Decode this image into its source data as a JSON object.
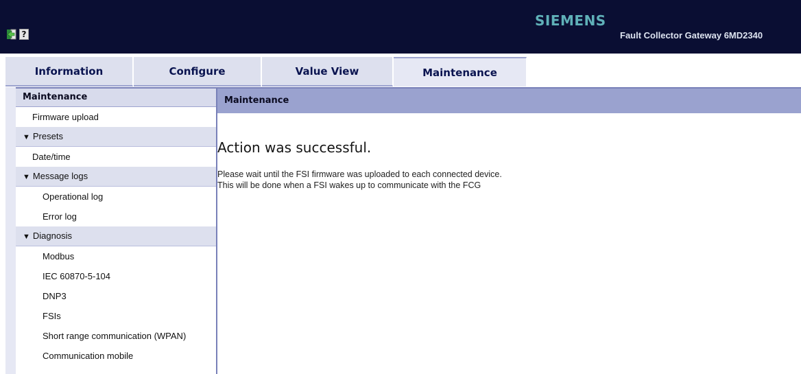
{
  "header": {
    "brand": "SIEMENS",
    "product": "Fault Collector Gateway 6MD2340",
    "icons": [
      "exit-icon",
      "help-icon"
    ],
    "help_glyph": "?"
  },
  "tabs": [
    {
      "label": "Information",
      "active": false
    },
    {
      "label": "Configure",
      "active": false
    },
    {
      "label": "Value View",
      "active": false
    },
    {
      "label": "Maintenance",
      "active": true
    }
  ],
  "sidebar": {
    "title": "Maintenance",
    "items": [
      {
        "label": "Firmware upload"
      },
      {
        "label": "Presets",
        "type": "group"
      },
      {
        "label": "Date/time"
      },
      {
        "label": "Message logs",
        "type": "group"
      },
      {
        "label": "Operational log"
      },
      {
        "label": "Error log"
      },
      {
        "label": "Diagnosis",
        "type": "group"
      },
      {
        "label": "Modbus"
      },
      {
        "label": "IEC 60870-5-104"
      },
      {
        "label": "DNP3"
      },
      {
        "label": "FSIs"
      },
      {
        "label": "Short range communication (WPAN)"
      },
      {
        "label": "Communication mobile"
      }
    ],
    "group_marker": "▼"
  },
  "main": {
    "title": "Maintenance",
    "status_title": "Action was successful.",
    "message_lines": [
      "Please wait until the FSI firmware was uploaded to each connected device.",
      "This will be done when a FSI wakes up to communicate with the FCG"
    ]
  },
  "colors": {
    "header_bg": "#0a0e33",
    "brand": "#5fb0b8",
    "tab_bg": "#dde0ee",
    "accent": "#7880b8",
    "main_header_bg": "#9aa2cf"
  }
}
